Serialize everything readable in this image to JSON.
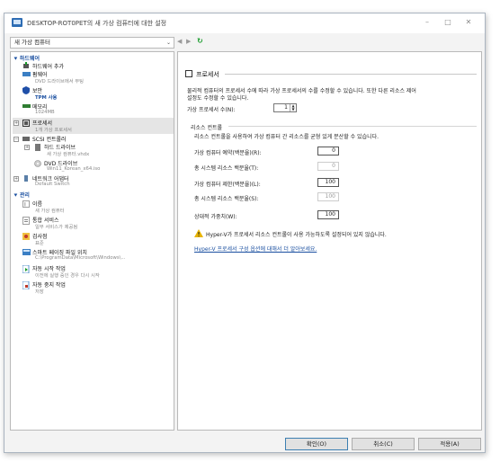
{
  "window": {
    "title": "DESKTOP-ROT0PET의 새 가상 컴퓨터에 대한 설정",
    "minimize": "–",
    "maximize": "□",
    "close": "✕"
  },
  "vm_selector": {
    "value": "새 가상 컴퓨터",
    "arrow": "⌄"
  },
  "nav": {
    "back": "◀",
    "forward": "▶",
    "refresh": "↻"
  },
  "sidebar": {
    "hardware_header": "하드웨어",
    "management_header": "관리",
    "items": [
      {
        "title": "하드웨어 추가",
        "sub": "",
        "icon": "add-hardware-icon"
      },
      {
        "title": "펌웨어",
        "sub": "DVD 드라이브에서 부팅",
        "icon": "firmware-icon"
      },
      {
        "title": "보안",
        "sub": "TPM 사용",
        "icon": "shield-icon"
      },
      {
        "title": "메모리",
        "sub": "1024MB",
        "icon": "memory-icon"
      },
      {
        "title": "프로세서",
        "sub": "1개 가상 프로세서",
        "icon": "processor-icon"
      },
      {
        "title": "SCSI 컨트롤러",
        "sub": "",
        "icon": "scsi-controller-icon"
      },
      {
        "title": "하드 드라이브",
        "sub": "새 가상 컴퓨터.vhdx",
        "icon": "hard-drive-icon"
      },
      {
        "title": "DVD 드라이브",
        "sub": "Win11_Korean_x64.iso",
        "icon": "dvd-drive-icon"
      },
      {
        "title": "네트워크 어댑터",
        "sub": "Default Switch",
        "icon": "network-adapter-icon"
      },
      {
        "title": "이름",
        "sub": "새 가상 컴퓨터",
        "icon": "name-icon"
      },
      {
        "title": "통합 서비스",
        "sub": "일부 서비스가 제공됨",
        "icon": "integration-services-icon"
      },
      {
        "title": "검사점",
        "sub": "표준",
        "icon": "checkpoint-icon"
      },
      {
        "title": "스마트 페이징 파일 위치",
        "sub": "C:\\ProgramData\\Microsoft\\Windows\\...",
        "icon": "smart-paging-icon"
      },
      {
        "title": "자동 시작 작업",
        "sub": "이전에 실행 중인 경우 다시 시작",
        "icon": "auto-start-icon"
      },
      {
        "title": "자동 중지 작업",
        "sub": "저장",
        "icon": "auto-stop-icon"
      }
    ]
  },
  "processor": {
    "header": "프로세서",
    "description_1": "물리적 컴퓨터의 프로세서 수에 따라 가상 프로세서의 수를 수정할 수 있습니다. 또한 다른 리소스 제어",
    "description_2": "설정도 수정할 수 있습니다.",
    "count_label": "가상 프로세서 수(N):",
    "count_value": "1",
    "resource_header": "리소스 컨트롤",
    "resource_description": "리소스 컨트롤을 사용하여 가상 컴퓨터 간 리소스를 균형 있게 분산할 수 있습니다.",
    "fields": [
      {
        "label": "가상 컴퓨터 예약(백분율)(R):",
        "value": "0",
        "enabled": true
      },
      {
        "label": "총 시스템 리소스 백분율(T):",
        "value": "0",
        "enabled": false
      },
      {
        "label": "가상 컴퓨터 제한(백분율)(L):",
        "value": "100",
        "enabled": true
      },
      {
        "label": "총 시스템 리소스 백분율(S):",
        "value": "100",
        "enabled": false
      },
      {
        "label": "상대적 가중치(W):",
        "value": "100",
        "enabled": true
      }
    ],
    "warning": "Hyper-V가 프로세서 리소스 컨트롤이 사용 가능하도록 설정되어 있지 않습니다.",
    "link": "Hyper-V 프로세서 구성 옵션에 대해서 더 알아보세요."
  },
  "buttons": {
    "ok": "확인(O)",
    "cancel": "취소(C)",
    "apply": "적용(A)"
  },
  "colors": {
    "accent": "#1a4fa0",
    "refresh": "#1a9c2c",
    "warning": "#e8b400"
  }
}
